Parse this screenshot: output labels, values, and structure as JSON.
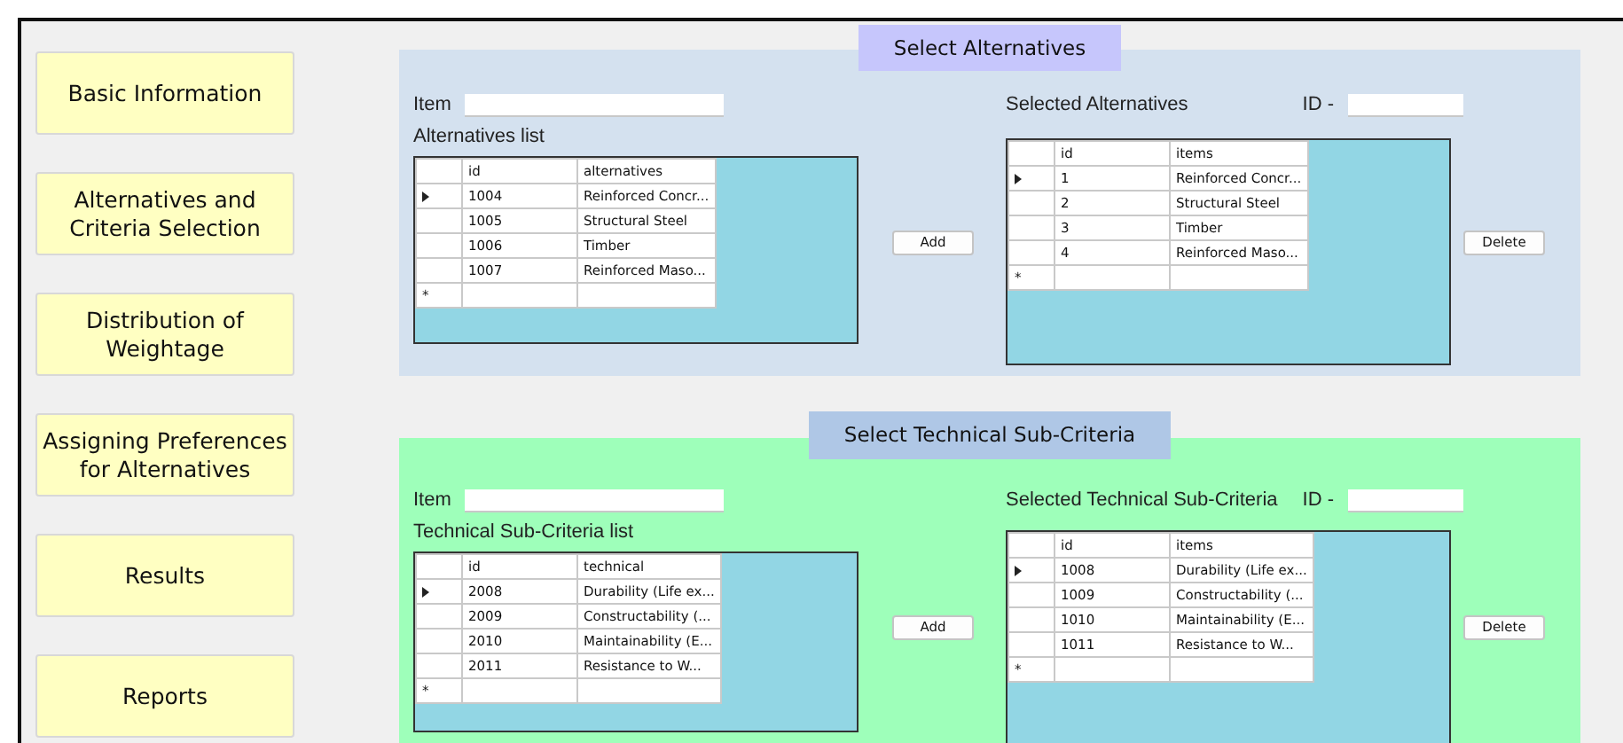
{
  "sidebar": {
    "items": [
      {
        "label": "Basic Information"
      },
      {
        "label": "Alternatives and Criteria Selection"
      },
      {
        "label": "Distribution of Weightage"
      },
      {
        "label": "Assigning Preferences for Alternatives"
      },
      {
        "label": "Results"
      },
      {
        "label": "Reports"
      }
    ]
  },
  "sections": [
    {
      "kind": "alternatives",
      "title": "Select Alternatives",
      "color": "#d4e1ef",
      "item_label": "Item",
      "list_label": "Alternatives list",
      "list_grid": {
        "columns": [
          "id",
          "alternatives"
        ],
        "new_row_marker": "*",
        "rows": [
          {
            "cells": [
              "1004",
              "Reinforced Concr..."
            ],
            "current": true
          },
          {
            "cells": [
              "1005",
              "Structural Steel"
            ],
            "current": false
          },
          {
            "cells": [
              "1006",
              "Timber"
            ],
            "current": false
          },
          {
            "cells": [
              "1007",
              "Reinforced Maso..."
            ],
            "current": false
          }
        ]
      },
      "add_button": "Add",
      "selected_label": "Selected Alternatives",
      "id_label": "ID -",
      "selected_grid": {
        "columns": [
          "id",
          "items"
        ],
        "new_row_marker": "*",
        "rows": [
          {
            "cells": [
              "1",
              "Reinforced Concr..."
            ],
            "current": true
          },
          {
            "cells": [
              "2",
              "Structural Steel"
            ],
            "current": false
          },
          {
            "cells": [
              "3",
              "Timber"
            ],
            "current": false
          },
          {
            "cells": [
              "4",
              "Reinforced Maso..."
            ],
            "current": false
          }
        ]
      },
      "delete_button": "Delete"
    },
    {
      "kind": "technical",
      "title": "Select Technical Sub-Criteria",
      "color": "#9effba",
      "item_label": "Item",
      "list_label": "Technical Sub-Criteria list",
      "list_grid": {
        "columns": [
          "id",
          "technical"
        ],
        "new_row_marker": "*",
        "rows": [
          {
            "cells": [
              "2008",
              "Durability (Life ex..."
            ],
            "current": true
          },
          {
            "cells": [
              "2009",
              "Constructability (..."
            ],
            "current": false
          },
          {
            "cells": [
              "2010",
              "Maintainability (E..."
            ],
            "current": false
          },
          {
            "cells": [
              "2011",
              "Resistance to W..."
            ],
            "current": false
          }
        ]
      },
      "add_button": "Add",
      "selected_label": "Selected Technical Sub-Criteria",
      "id_label": "ID -",
      "selected_grid": {
        "columns": [
          "id",
          "items"
        ],
        "new_row_marker": "*",
        "rows": [
          {
            "cells": [
              "1008",
              "Durability (Life ex..."
            ],
            "current": true
          },
          {
            "cells": [
              "1009",
              "Constructability (..."
            ],
            "current": false
          },
          {
            "cells": [
              "1010",
              "Maintainability (E..."
            ],
            "current": false
          },
          {
            "cells": [
              "1011",
              "Resistance to W..."
            ],
            "current": false
          }
        ]
      },
      "delete_button": "Delete"
    }
  ]
}
